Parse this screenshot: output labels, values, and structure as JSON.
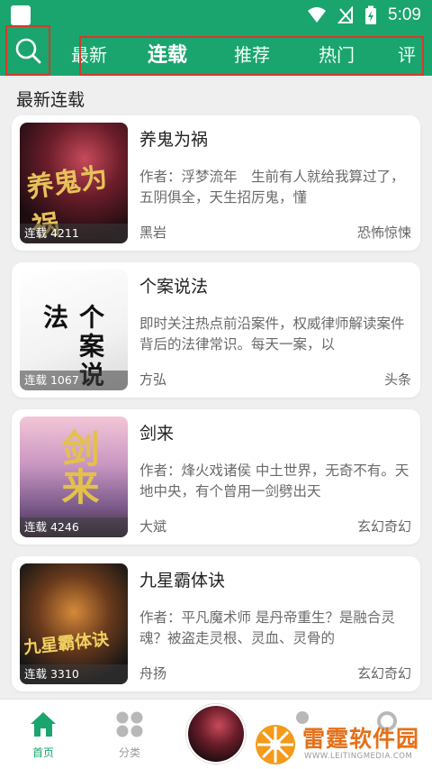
{
  "status_bar": {
    "time": "5:09"
  },
  "tabs": [
    "最新",
    "连载",
    "推荐",
    "热门",
    "评"
  ],
  "active_tab": "连载",
  "section_title": "最新连载",
  "books": [
    {
      "title": "养鬼为祸",
      "desc": "作者：浮梦流年　生前有人就给我算过了，五阴俱全，天生招厉鬼，懂",
      "author": "黑岩",
      "category": "恐怖惊悚",
      "badge": "连载 4211",
      "cover_text": "养鬼为祸"
    },
    {
      "title": "个案说法",
      "desc": "即时关注热点前沿案件，权威律师解读案件背后的法律常识。每天一案，以",
      "author": "方弘",
      "category": "头条",
      "badge": "连载 1067",
      "cover_text": "个案说法"
    },
    {
      "title": "剑来",
      "desc": "作者：烽火戏诸侯 中土世界，无奇不有。天地中央，有个曾用一剑劈出天",
      "author": "大斌",
      "category": "玄幻奇幻",
      "badge": "连载 4246",
      "cover_text": "剑来"
    },
    {
      "title": "九星霸体诀",
      "desc": "作者：平凡魔术师 是丹帝重生？是融合灵魂？被盗走灵根、灵血、灵骨的",
      "author": "舟扬",
      "category": "玄幻奇幻",
      "badge": "连载 3310",
      "cover_text": "九星霸体诀"
    }
  ],
  "bottom_nav": [
    {
      "label": "首页",
      "icon": "home-icon",
      "active": true
    },
    {
      "label": "分类",
      "icon": "category-grid-icon",
      "active": false
    }
  ],
  "watermark": {
    "text": "雷霆软件园",
    "url": "WWW.LEITINGMEDIA.COM"
  },
  "colors": {
    "primary": "#1aa56e",
    "highlight_box": "#d63a2a",
    "nav_inactive": "#b8b8b8"
  }
}
